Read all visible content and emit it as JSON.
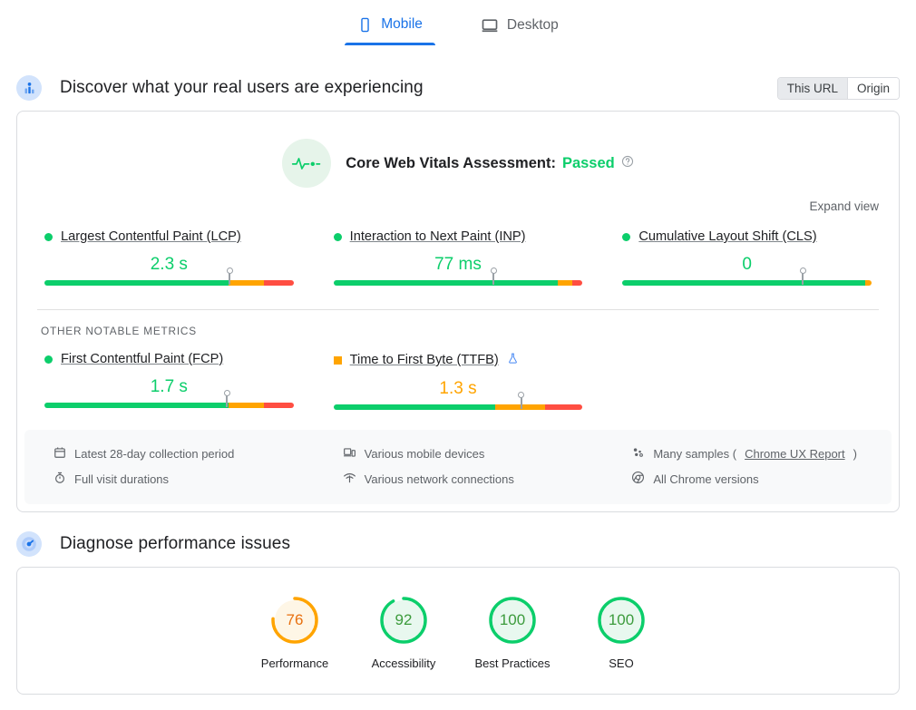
{
  "tabs": [
    {
      "label": "Mobile",
      "icon": "mobile-icon",
      "active": true
    },
    {
      "label": "Desktop",
      "icon": "desktop-icon",
      "active": false
    }
  ],
  "field_section": {
    "icon": "users-chart-icon",
    "title": "Discover what your real users are experiencing",
    "toggle": {
      "this_url": "This URL",
      "origin": "Origin",
      "selected": "This URL"
    },
    "assessment": {
      "icon": "pulse-icon",
      "label": "Core Web Vitals Assessment:",
      "status": "Passed",
      "status_color": "#0cce6b",
      "help_icon": "help-icon"
    },
    "expand_label": "Expand view",
    "core_metrics": [
      {
        "name": "Largest Contentful Paint (LCP)",
        "marker_shape": "circle",
        "marker_color": "#0cce6b",
        "value": "2.3 s",
        "value_color": "green",
        "good_pct": 74,
        "mid_pct": 14,
        "poor_pct": 12,
        "needle_pct": 74
      },
      {
        "name": "Interaction to Next Paint (INP)",
        "marker_shape": "circle",
        "marker_color": "#0cce6b",
        "value": "77 ms",
        "value_color": "green",
        "good_pct": 90,
        "mid_pct": 6,
        "poor_pct": 4,
        "needle_pct": 64
      },
      {
        "name": "Cumulative Layout Shift (CLS)",
        "marker_shape": "circle",
        "marker_color": "#0cce6b",
        "value": "0",
        "value_color": "green",
        "good_pct": 97.5,
        "mid_pct": 2.5,
        "poor_pct": 0,
        "needle_pct": 72
      }
    ],
    "other_label": "OTHER NOTABLE METRICS",
    "other_metrics": [
      {
        "name": "First Contentful Paint (FCP)",
        "marker_shape": "circle",
        "marker_color": "#0cce6b",
        "value": "1.7 s",
        "value_color": "green",
        "good_pct": 74,
        "mid_pct": 14,
        "poor_pct": 12,
        "needle_pct": 73,
        "extra_icon": null
      },
      {
        "name": "Time to First Byte (TTFB)",
        "marker_shape": "square",
        "marker_color": "#ffa400",
        "value": "1.3 s",
        "value_color": "orange",
        "good_pct": 65,
        "mid_pct": 20,
        "poor_pct": 15,
        "needle_pct": 75,
        "extra_icon": "experiment-flask-icon"
      }
    ],
    "notes": [
      {
        "icon": "calendar-icon",
        "text": "Latest 28-day collection period"
      },
      {
        "icon": "stopwatch-icon",
        "text": "Full visit durations"
      },
      {
        "icon": "devices-icon",
        "text": "Various mobile devices"
      },
      {
        "icon": "network-icon",
        "text": "Various network connections"
      },
      {
        "icon": "samples-icon",
        "text": "Many samples (",
        "link": "Chrome UX Report",
        "text_after": ")"
      },
      {
        "icon": "chrome-icon",
        "text": "All Chrome versions"
      }
    ]
  },
  "lab_section": {
    "icon": "gauge-icon",
    "title": "Diagnose performance issues",
    "scores": [
      {
        "label": "Performance",
        "value": 76,
        "color": "#ffa400",
        "bg": "#fef6e6",
        "text_color": "#e8700f"
      },
      {
        "label": "Accessibility",
        "value": 92,
        "color": "#0cce6b",
        "bg": "#e8f8ef",
        "text_color": "#3c9b3c"
      },
      {
        "label": "Best Practices",
        "value": 100,
        "color": "#0cce6b",
        "bg": "#e8f8ef",
        "text_color": "#3c9b3c"
      },
      {
        "label": "SEO",
        "value": 100,
        "color": "#0cce6b",
        "bg": "#e8f8ef",
        "text_color": "#3c9b3c"
      }
    ]
  }
}
